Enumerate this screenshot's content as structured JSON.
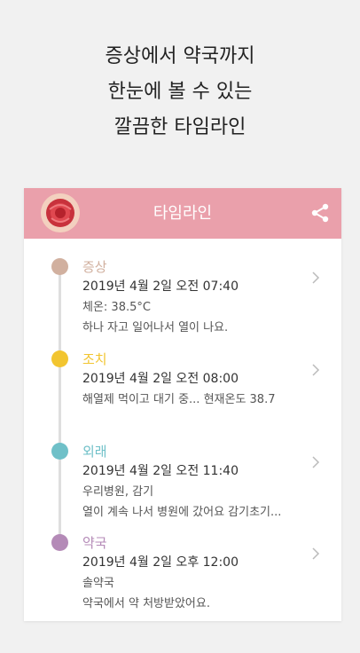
{
  "headline": [
    "증상에서 약국까지",
    "한눈에 볼 수 있는",
    "깔끔한 타임라인"
  ],
  "appbar": {
    "title": "타임라인",
    "color": "#eaa0ab"
  },
  "items": [
    {
      "category": "증상",
      "color": "#d1b09f",
      "date": "2019년 4월 2일 오전 07:40",
      "line1": "체온: 38.5°C",
      "line2": "하나 자고 일어나서 열이 나요."
    },
    {
      "category": "조치",
      "color": "#f2c530",
      "date": "2019년 4월 2일 오전 08:00",
      "line1": "해열제 먹이고 대기 중... 현재온도 38.7",
      "line2": ""
    },
    {
      "category": "외래",
      "color": "#6fc0c8",
      "date": "2019년 4월 2일 오전 11:40",
      "line1": "우리병원, 감기",
      "line2": "열이 계속 나서 병원에 갔어요 감기초기..."
    },
    {
      "category": "약국",
      "color": "#b48ab7",
      "date": "2019년 4월 2일 오후 12:00",
      "line1": "솔약국",
      "line2": "약국에서 약 처방받았어요."
    }
  ]
}
